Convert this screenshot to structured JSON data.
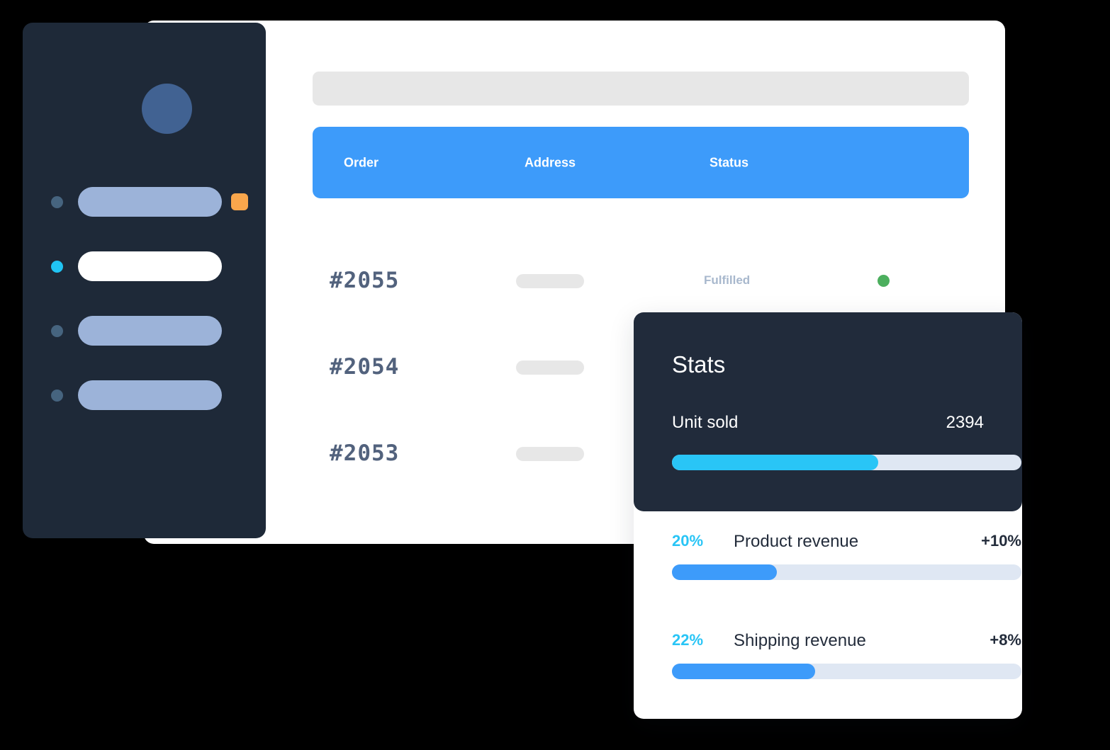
{
  "sidebar": {
    "avatar": {
      "name": "user-avatar",
      "color": "#416292"
    },
    "items": [
      {
        "id": "nav-item-1",
        "dot_color": "#46647f",
        "pill_color": "#9cb3d9",
        "active": false,
        "badge": "",
        "badge_color": "#f9a64c",
        "has_badge": true
      },
      {
        "id": "nav-item-2",
        "dot_color": "#20c4f4",
        "pill_color": "#ffffff",
        "active": true,
        "badge": "",
        "badge_color": "",
        "has_badge": false
      },
      {
        "id": "nav-item-3",
        "dot_color": "#46647f",
        "pill_color": "#9cb3d9",
        "active": false,
        "badge": "",
        "badge_color": "",
        "has_badge": false
      },
      {
        "id": "nav-item-4",
        "dot_color": "#46647f",
        "pill_color": "#9cb3d9",
        "active": false,
        "badge": "",
        "badge_color": "",
        "has_badge": false
      }
    ]
  },
  "search": {
    "value": "",
    "placeholder": ""
  },
  "orders_table": {
    "columns": [
      "Order",
      "Address",
      "Status"
    ],
    "rows": [
      {
        "order": "#2055",
        "address": "",
        "status": "Fulfilled",
        "status_dot_color": "#4caf5e",
        "has_status": true
      },
      {
        "order": "#2054",
        "address": "",
        "status": "",
        "status_dot_color": "",
        "has_status": false
      },
      {
        "order": "#2053",
        "address": "",
        "status": "",
        "status_dot_color": "",
        "has_status": false
      }
    ]
  },
  "stats_card": {
    "title": "Stats",
    "unit_sold": {
      "label": "Unit sold",
      "value": "2394",
      "progress_percent": 59,
      "bar_color": "#29c5f6"
    },
    "metrics": [
      {
        "percent_label": "20%",
        "name": "Product revenue",
        "delta": "+10%",
        "progress_percent": 30,
        "bar_color": "#3d9bfa"
      },
      {
        "percent_label": "22%",
        "name": "Shipping revenue",
        "delta": "+8%",
        "progress_percent": 41,
        "bar_color": "#3d9bfa"
      }
    ]
  },
  "theme": {
    "accent_blue": "#3d9bfa",
    "accent_cyan": "#29c5f6",
    "sidebar_bg": "#1e2938",
    "stats_head_bg": "#212b3b",
    "orange_badge": "#f9a64c",
    "green_status": "#4caf5e",
    "order_text": "#52627d",
    "status_text": "#a8b8cd",
    "track_bg": "#dfe7f3",
    "placeholder_gray": "#e7e7e7"
  }
}
